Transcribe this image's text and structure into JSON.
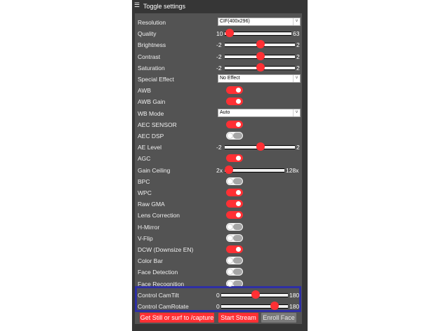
{
  "header": {
    "menu_icon": "☰",
    "title": "Toggle settings"
  },
  "colors": {
    "accent": "#ff3034",
    "panel": "#363636",
    "inner": "#535353",
    "highlight": "#2e2fa4"
  },
  "rows": [
    {
      "kind": "select",
      "label": "Resolution",
      "value": "CIF(400x296)"
    },
    {
      "kind": "slider",
      "label": "Quality",
      "min": "10",
      "max": "63",
      "value": 10
    },
    {
      "kind": "slider",
      "label": "Brightness",
      "min": "-2",
      "max": "2",
      "value": 0
    },
    {
      "kind": "slider",
      "label": "Contrast",
      "min": "-2",
      "max": "2",
      "value": 0
    },
    {
      "kind": "slider",
      "label": "Saturation",
      "min": "-2",
      "max": "2",
      "value": 0
    },
    {
      "kind": "select",
      "label": "Special Effect",
      "value": "No Effect"
    },
    {
      "kind": "toggle",
      "label": "AWB",
      "on": true
    },
    {
      "kind": "toggle",
      "label": "AWB Gain",
      "on": true
    },
    {
      "kind": "select",
      "label": "WB Mode",
      "value": "Auto"
    },
    {
      "kind": "toggle",
      "label": "AEC SENSOR",
      "on": true
    },
    {
      "kind": "toggle",
      "label": "AEC DSP",
      "on": false
    },
    {
      "kind": "slider",
      "label": "AE Level",
      "min": "-2",
      "max": "2",
      "value": 0
    },
    {
      "kind": "toggle",
      "label": "AGC",
      "on": true
    },
    {
      "kind": "slider",
      "label": "Gain Ceiling",
      "min": "2x",
      "max": "128x",
      "value": 0
    },
    {
      "kind": "toggle",
      "label": "BPC",
      "on": false
    },
    {
      "kind": "toggle",
      "label": "WPC",
      "on": true
    },
    {
      "kind": "toggle",
      "label": "Raw GMA",
      "on": true
    },
    {
      "kind": "toggle",
      "label": "Lens Correction",
      "on": true
    },
    {
      "kind": "toggle",
      "label": "H-Mirror",
      "on": false
    },
    {
      "kind": "toggle",
      "label": "V-Flip",
      "on": false
    },
    {
      "kind": "toggle",
      "label": "DCW (Downsize EN)",
      "on": true
    },
    {
      "kind": "toggle",
      "label": "Color Bar",
      "on": false
    },
    {
      "kind": "toggle",
      "label": "Face Detection",
      "on": false
    },
    {
      "kind": "toggle",
      "label": "Face Recognition",
      "on": false
    },
    {
      "kind": "slider",
      "label": "Control CamTilt",
      "min": "0",
      "max": "180",
      "value": 90
    },
    {
      "kind": "slider",
      "label": "Control CamRotate",
      "min": "0",
      "max": "180",
      "value": 150
    }
  ],
  "buttons": {
    "capture": "Get Still or surf to /capture",
    "stream": "Start Stream",
    "enroll": "Enroll Face"
  }
}
